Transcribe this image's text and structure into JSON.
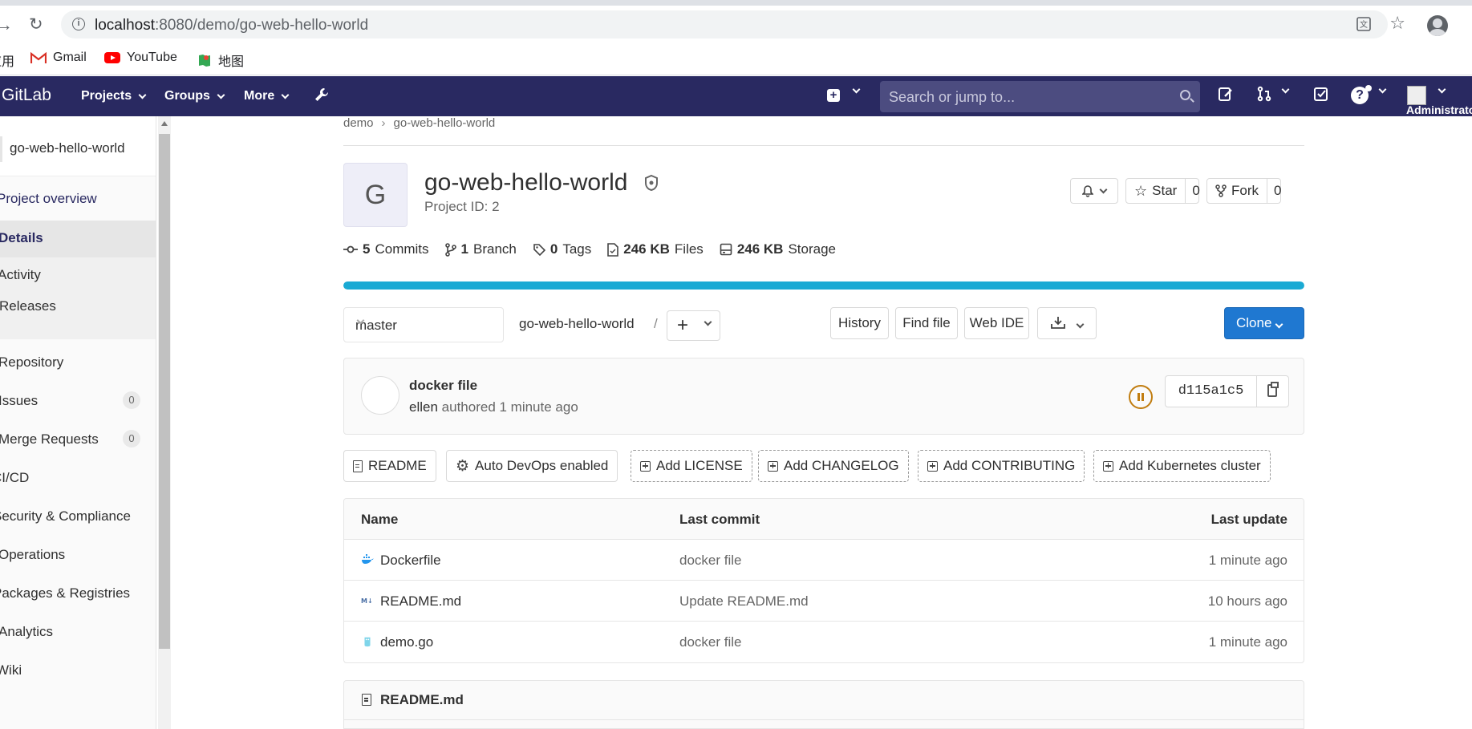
{
  "browser": {
    "url_host": "localhost",
    "url_rest": ":8080/demo/go-web-hello-world",
    "bookmarks": [
      {
        "label": "应用"
      },
      {
        "label": "Gmail"
      },
      {
        "label": "YouTube"
      },
      {
        "label": "地图"
      }
    ]
  },
  "navbar": {
    "logo": "GitLab",
    "menus": [
      "Projects",
      "Groups",
      "More"
    ],
    "search_placeholder": "Search or jump to...",
    "user_label": "Administrator"
  },
  "sidebar": {
    "project_name": "go-web-hello-world",
    "overview_label": "Project overview",
    "sub_items": [
      "Details",
      "Activity",
      "Releases"
    ],
    "items": [
      {
        "label": "Repository"
      },
      {
        "label": "Issues",
        "badge": "0"
      },
      {
        "label": "Merge Requests",
        "badge": "0"
      },
      {
        "label": "CI/CD"
      },
      {
        "label": "Security & Compliance"
      },
      {
        "label": "Operations"
      },
      {
        "label": "Packages & Registries"
      },
      {
        "label": "Analytics"
      },
      {
        "label": "Wiki"
      }
    ]
  },
  "breadcrumb": [
    "demo",
    "go-web-hello-world"
  ],
  "project": {
    "avatar_letter": "G",
    "title": "go-web-hello-world",
    "id_label": "Project ID: 2",
    "star_label": "Star",
    "star_count": "0",
    "fork_label": "Fork",
    "fork_count": "0"
  },
  "stats": {
    "commits_num": "5",
    "commits_label": "Commits",
    "branch_num": "1",
    "branch_label": "Branch",
    "tags_num": "0",
    "tags_label": "Tags",
    "files_num": "246 KB",
    "files_label": "Files",
    "storage_num": "246 KB",
    "storage_label": "Storage"
  },
  "language_bar": {
    "percent": 100,
    "color": "#1aaad4"
  },
  "repo_toolbar": {
    "branch": "master",
    "path": "go-web-hello-world",
    "slash": "/",
    "history": "History",
    "find_file": "Find file",
    "web_ide": "Web IDE",
    "clone": "Clone"
  },
  "last_commit": {
    "title": "docker file",
    "author": "ellen",
    "authored": "authored 1 minute ago",
    "sha": "d115a1c5"
  },
  "quick_buttons": {
    "readme": "README",
    "auto_devops": "Auto DevOps enabled",
    "add_license": "Add LICENSE",
    "add_changelog": "Add CHANGELOG",
    "add_contributing": "Add CONTRIBUTING",
    "add_k8s": "Add Kubernetes cluster"
  },
  "file_tree": {
    "headers": {
      "name": "Name",
      "last_commit": "Last commit",
      "last_update": "Last update"
    },
    "rows": [
      {
        "name": "Dockerfile",
        "commit": "docker file",
        "updated": "1 minute ago"
      },
      {
        "name": "README.md",
        "commit": "Update README.md",
        "updated": "10 hours ago"
      },
      {
        "name": "demo.go",
        "commit": "docker file",
        "updated": "1 minute ago"
      }
    ]
  },
  "readme_title": "README.md"
}
